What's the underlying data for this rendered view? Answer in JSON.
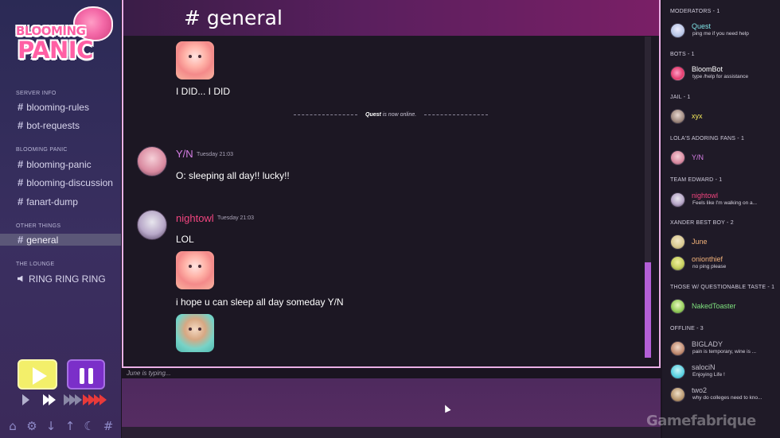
{
  "logo": {
    "line1": "BLOOMING",
    "line2": "PANIC"
  },
  "sidebar": {
    "categories": [
      {
        "label": "SERVER INFO",
        "channels": [
          {
            "name": "blooming-rules"
          },
          {
            "name": "bot-requests"
          }
        ]
      },
      {
        "label": "BLOOMING PANIC",
        "channels": [
          {
            "name": "blooming-panic"
          },
          {
            "name": "blooming-discussion"
          },
          {
            "name": "fanart-dump"
          }
        ]
      },
      {
        "label": "OTHER THINGS",
        "channels": [
          {
            "name": "general",
            "active": true
          }
        ]
      },
      {
        "label": "THE LOUNGE",
        "channels": [
          {
            "name": "RING RING RING",
            "voice": true
          }
        ]
      }
    ]
  },
  "controls": {
    "play_icon": "play-icon",
    "pause_icon": "pause-icon",
    "play_color": "#f3ef6a",
    "pause_color": "#7b2fc9",
    "speed_icons": [
      "speed-1x-icon",
      "speed-2x-icon",
      "speed-3x-icon",
      "speed-4x-icon"
    ]
  },
  "toolbar": {
    "icons": [
      "home-icon",
      "gear-icon",
      "arrow-down-icon",
      "arrow-up-icon",
      "moon-icon",
      "hash-icon"
    ],
    "glyphs": [
      "⌂",
      "⚙",
      "↓",
      "↑",
      "☾",
      "#"
    ]
  },
  "chat": {
    "hash": "#",
    "title": "general",
    "messages": [
      {
        "text": "I DID... I DID"
      },
      {
        "author": "Y/N",
        "author_color": "#d77fe6",
        "timestamp": "Tuesday 21:03",
        "text": "O: sleeping all day!! lucky!!"
      },
      {
        "author": "nightowl",
        "author_color": "#f1457f",
        "timestamp": "Tuesday 21:03",
        "text": "LOL",
        "text2": "i hope u can sleep all day someday Y/N"
      }
    ],
    "system": {
      "user": "Quest",
      "text": "is now online."
    },
    "typing": "June is typing..."
  },
  "members": {
    "groups": [
      {
        "label": "MODERATORS - 1",
        "members": [
          {
            "name": "Quest",
            "status": "ping me if you need help",
            "color": "#7fe3e6"
          }
        ]
      },
      {
        "label": "BOTS - 1",
        "members": [
          {
            "name": "BloomBot",
            "status": "type /help for assistance",
            "color": "#ffffff"
          }
        ]
      },
      {
        "label": "JAIL - 1",
        "members": [
          {
            "name": "xyx",
            "status": "",
            "color": "#f3e85a"
          }
        ]
      },
      {
        "label": "LOLA'S ADORING FANS - 1",
        "members": [
          {
            "name": "Y/N",
            "status": "",
            "color": "#d77fe6"
          }
        ]
      },
      {
        "label": "TEAM EDWARD - 1",
        "members": [
          {
            "name": "nightowl",
            "status": "Feels like I'm walking on a...",
            "color": "#f1457f"
          }
        ]
      },
      {
        "label": "XANDER BEST BOY - 2",
        "members": [
          {
            "name": "June",
            "status": "",
            "color": "#f2b27a"
          },
          {
            "name": "onionthief",
            "status": "no ping please",
            "color": "#f2b27a"
          }
        ]
      },
      {
        "label": "THOSE W/ QUESTIONABLE TASTE - 1",
        "members": [
          {
            "name": "NakedToaster",
            "status": "",
            "color": "#7fe37f"
          }
        ]
      },
      {
        "label": "OFFLINE - 3",
        "members": [
          {
            "name": "BIGLADY",
            "status": "pain is temporary, wine is ...",
            "color": "#c0bcc8"
          },
          {
            "name": "salociN",
            "status": "Enjoying Life !",
            "color": "#c0bcc8"
          },
          {
            "name": "two2",
            "status": "why do colleges need to kno...",
            "color": "#c0bcc8"
          }
        ]
      }
    ]
  },
  "watermark": "Gamefabrique"
}
